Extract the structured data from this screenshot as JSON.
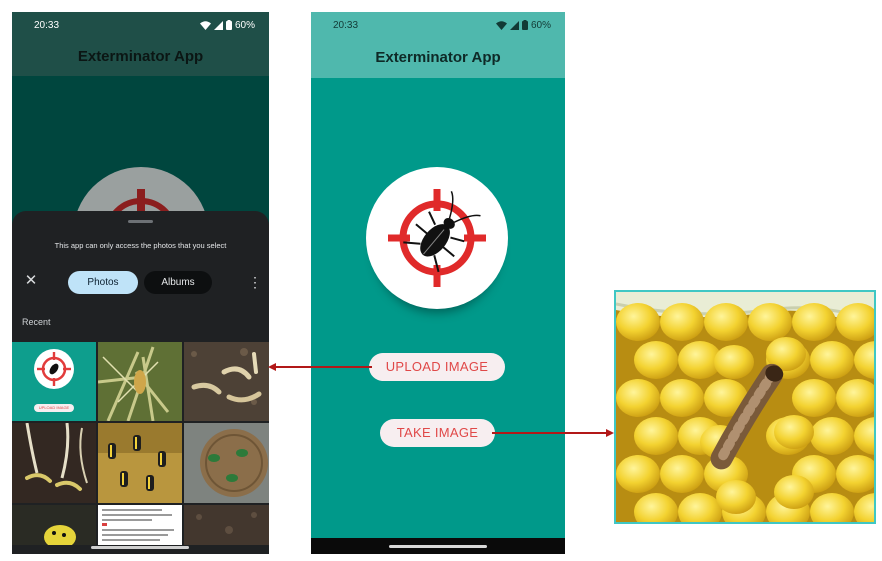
{
  "left_phone": {
    "status": {
      "time": "20:33",
      "battery": "60%"
    },
    "app_title": "Exterminator App",
    "picker": {
      "note": "This app can only access the photos that you select",
      "tabs": [
        {
          "label": "Photos",
          "selected": true
        },
        {
          "label": "Albums",
          "selected": false
        }
      ],
      "section_label": "Recent",
      "thumb_upload_label": "UPLOAD IMAGE",
      "thumbnails": [
        "app-screenshot",
        "insect-larva-on-plant",
        "grubs-in-soil",
        "root-worms-in-soil",
        "striped-beetles-on-leaf",
        "beetles-on-coin",
        "yellow-beetle",
        "document-screenshot",
        "soil"
      ]
    },
    "icons": {
      "close": "close-icon",
      "more": "more-vert-icon",
      "wifi": "wifi-icon",
      "signal": "signal-icon",
      "battery": "battery-icon"
    }
  },
  "middle_phone": {
    "status": {
      "time": "20:33",
      "battery": "60%"
    },
    "app_title": "Exterminator App",
    "upload_label": "UPLOAD IMAGE",
    "take_label": "TAKE IMAGE",
    "logo": "crosshair-cockroach-icon"
  },
  "right_photo": {
    "subject": "corn-ear-with-larva"
  },
  "colors": {
    "app_teal": "#00998a",
    "app_bar_teal": "#4fb8ad",
    "button_text_red": "#e04848",
    "arrow_red": "#b21818",
    "frame_cyan": "#3fc7c4",
    "picker_selected": "#bfe3f8"
  }
}
